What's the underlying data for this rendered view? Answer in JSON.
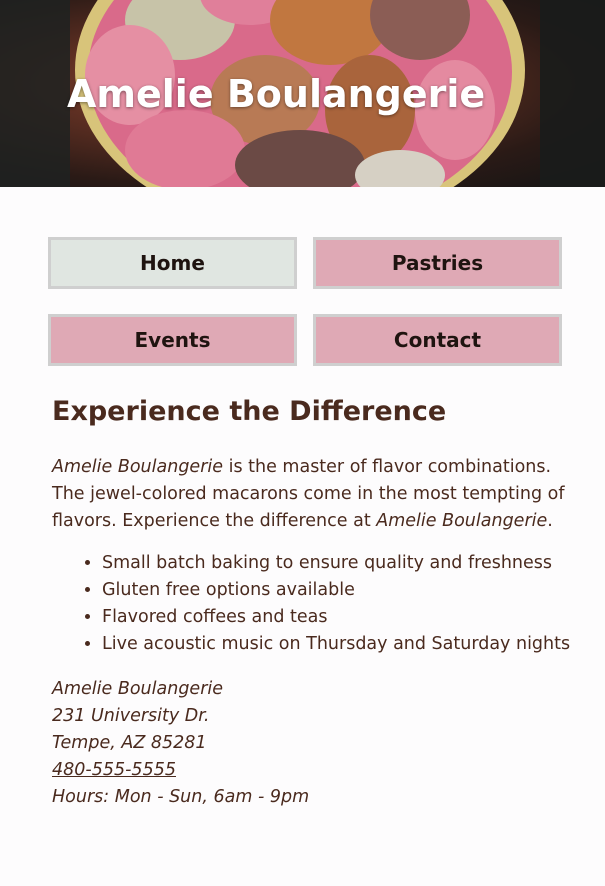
{
  "header": {
    "title": "Amelie Boulangerie"
  },
  "nav": {
    "items": [
      {
        "label": "Home",
        "color": "#e0e6e1"
      },
      {
        "label": "Pastries",
        "color": "#dfa9b5"
      },
      {
        "label": "Events",
        "color": "#dfa9b5"
      },
      {
        "label": "Contact",
        "color": "#dfa9b5"
      }
    ]
  },
  "main": {
    "heading": "Experience the Difference",
    "intro": {
      "name_1": "Amelie Boulangerie",
      "text_1": " is the master of flavor combinations. The jewel-colored macarons come in the most tempting of flavors. Experience the difference at ",
      "name_2": "Amelie Boulangerie",
      "text_2": "."
    },
    "features": [
      "Small batch baking to ensure quality and freshness",
      "Gluten free options available",
      "Flavored coffees and teas",
      "Live acoustic music on Thursday and Saturday nights"
    ]
  },
  "contact": {
    "name": "Amelie Boulangerie",
    "street": "231 University Dr.",
    "city": "Tempe, AZ 85281",
    "phone": "480-555-5555",
    "hours": "Hours: Mon - Sun, 6am - 9pm"
  },
  "colors": {
    "text": "#4a2a1e",
    "nav_active": "#e0e6e1",
    "nav_default": "#dfa9b5",
    "nav_border": "#cfcfcf"
  }
}
